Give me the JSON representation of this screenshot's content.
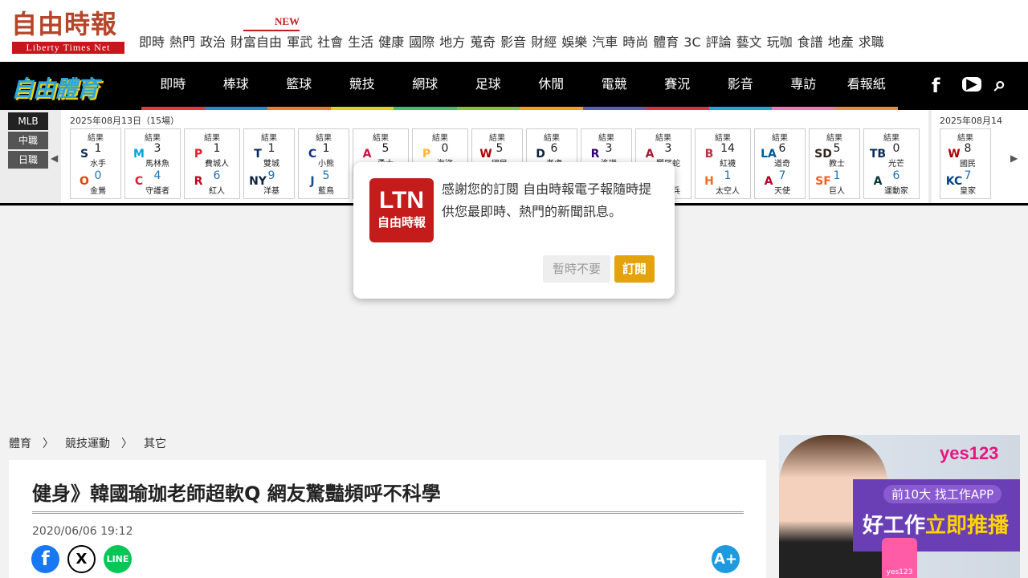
{
  "site": {
    "logo_cn": "自由時報",
    "logo_en": "Liberty Times Net",
    "new_badge": "NEW",
    "nav": [
      "即時",
      "熱門",
      "政治",
      "財富自由",
      "軍武",
      "社會",
      "生活",
      "健康",
      "國際",
      "地方",
      "蒐奇",
      "影音",
      "財經",
      "娛樂",
      "汽車",
      "時尚",
      "體育",
      "3C",
      "評論",
      "藝文",
      "玩咖",
      "食譜",
      "地產",
      "求職"
    ]
  },
  "sports": {
    "logo": "自由體育",
    "nav": [
      {
        "label": "即時",
        "color": "#e23b3b"
      },
      {
        "label": "棒球",
        "color": "#1f8fd0"
      },
      {
        "label": "籃球",
        "color": "#f07a2a"
      },
      {
        "label": "競技",
        "color": "#e2d21d"
      },
      {
        "label": "網球",
        "color": "#3fbf6a"
      },
      {
        "label": "足球",
        "color": "#82c341"
      },
      {
        "label": "休閒",
        "color": "#f0a21d"
      },
      {
        "label": "電競",
        "color": "#5b5fb8"
      },
      {
        "label": "賽況",
        "color": "#d8343c"
      },
      {
        "label": "影音",
        "color": "#1fa8d8"
      },
      {
        "label": "專訪",
        "color": "#e97cb8"
      },
      {
        "label": "看報紙",
        "color": "#f08a3a"
      }
    ],
    "social": {
      "facebook": "f",
      "youtube": "▶",
      "search": "⌕"
    }
  },
  "scores": {
    "leagues": [
      "MLB",
      "中職",
      "日職"
    ],
    "date1": "2025年08月13日（15場）",
    "date2": "2025年08月14",
    "games": [
      {
        "status": "結果",
        "t1": "水手",
        "s1": "1",
        "c1": "#0c2c56",
        "g1": "S",
        "t2": "金鶯",
        "s2": "0",
        "c2": "#df4601",
        "g2": "O"
      },
      {
        "status": "結果",
        "t1": "馬林魚",
        "s1": "3",
        "c1": "#00a3e0",
        "g1": "M",
        "t2": "守護者",
        "s2": "4",
        "c2": "#e31937",
        "g2": "C"
      },
      {
        "status": "結果",
        "t1": "費城人",
        "s1": "1",
        "c1": "#e81828",
        "g1": "P",
        "t2": "紅人",
        "s2": "6",
        "c2": "#c6011f",
        "g2": "R"
      },
      {
        "status": "結果",
        "t1": "雙城",
        "s1": "1",
        "c1": "#002b5c",
        "g1": "T",
        "t2": "洋基",
        "s2": "9",
        "c2": "#0c2340",
        "g2": "NY"
      },
      {
        "status": "結果",
        "t1": "小熊",
        "s1": "1",
        "c1": "#0e3386",
        "g1": "C",
        "t2": "藍鳥",
        "s2": "5",
        "c2": "#134a8e",
        "g2": "J"
      },
      {
        "status": "結果",
        "t1": "勇士",
        "s1": "5",
        "c1": "#ce1141",
        "g1": "A",
        "t2": "",
        "s2": "",
        "c2": "#888",
        "g2": ""
      },
      {
        "status": "結果",
        "t1": "海盜",
        "s1": "0",
        "c1": "#fdb827",
        "g1": "P",
        "t2": "",
        "s2": "",
        "c2": "#888",
        "g2": ""
      },
      {
        "status": "結果",
        "t1": "國民",
        "s1": "5",
        "c1": "#ab0003",
        "g1": "W",
        "t2": "",
        "s2": "",
        "c2": "#888",
        "g2": ""
      },
      {
        "status": "結果",
        "t1": "老虎",
        "s1": "6",
        "c1": "#0c2340",
        "g1": "D",
        "t2": "",
        "s2": "",
        "c2": "#888",
        "g2": ""
      },
      {
        "status": "結果",
        "t1": "洛磯",
        "s1": "3",
        "c1": "#33006f",
        "g1": "R",
        "t2": "",
        "s2": "",
        "c2": "#888",
        "g2": ""
      },
      {
        "status": "結果",
        "t1": "響尾蛇",
        "s1": "3",
        "c1": "#a71930",
        "g1": "A",
        "t2": "遊騎兵",
        "s2": "2",
        "c2": "#003278",
        "g2": "T"
      },
      {
        "status": "結果",
        "t1": "紅襪",
        "s1": "14",
        "c1": "#bd3039",
        "g1": "B",
        "t2": "太空人",
        "s2": "1",
        "c2": "#eb6e1f",
        "g2": "H"
      },
      {
        "status": "結果",
        "t1": "道奇",
        "s1": "6",
        "c1": "#005a9c",
        "g1": "LA",
        "t2": "天使",
        "s2": "7",
        "c2": "#ba0021",
        "g2": "A"
      },
      {
        "status": "結果",
        "t1": "教士",
        "s1": "5",
        "c1": "#2f241d",
        "g1": "SD",
        "t2": "巨人",
        "s2": "1",
        "c2": "#fd5a1e",
        "g2": "SF"
      },
      {
        "status": "結果",
        "t1": "光芒",
        "s1": "0",
        "c1": "#092c5c",
        "g1": "TB",
        "t2": "運動家",
        "s2": "6",
        "c2": "#003831",
        "g2": "A"
      },
      {
        "status": "結果",
        "t1": "國民",
        "s1": "8",
        "c1": "#ab0003",
        "g1": "W",
        "t2": "皇家",
        "s2": "7",
        "c2": "#004687",
        "g2": "KC"
      }
    ]
  },
  "popup": {
    "logo_big": "LTN",
    "logo_small": "自由時報",
    "message": "感謝您的訂閱 自由時報電子報隨時提供您最即時、熱門的新聞訊息。",
    "later": "暫時不要",
    "subscribe": "訂閱"
  },
  "breadcrumb": [
    "體育",
    "〉",
    "競技運動",
    "〉",
    "其它"
  ],
  "article": {
    "title": "健身》韓國瑜珈老師超軟Q 網友驚豔頻呼不科學",
    "date": "2020/06/06 19:12",
    "share": {
      "facebook": "f",
      "x": "X",
      "line": "LINE"
    },
    "fontsize": "A+"
  },
  "ad": {
    "brand": "yes123",
    "top10": "前10大 找工作APP",
    "slogan_a": "好工作",
    "slogan_b": "立即推播",
    "phone": "yes123"
  }
}
